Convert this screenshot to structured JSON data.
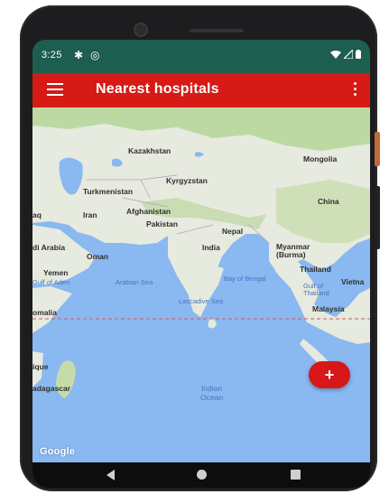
{
  "status_bar": {
    "time": "3:25",
    "icons": [
      "gear-icon",
      "circle-at-icon",
      "wifi-icon",
      "signal-icon",
      "battery-icon"
    ],
    "background": "#1e5e50"
  },
  "app_bar": {
    "title": "Nearest hospitals",
    "menu_icon": "hamburger-menu-icon",
    "overflow_icon": "more-vert-icon",
    "background": "#d61a16"
  },
  "map": {
    "labels": {
      "kazakhstan": "Kazakhstan",
      "mongolia": "Mongolia",
      "kyrgyzstan": "Kyrgyzstan",
      "turkmenistan": "Turkmenistan",
      "afghanistan": "Afghanistan",
      "iraq": "aq",
      "iran": "Iran",
      "pakistan": "Pakistan",
      "china": "China",
      "nepal": "Nepal",
      "saudi_arabia": "di Arabia",
      "oman": "Oman",
      "india": "India",
      "myanmar": "Myanmar\n(Burma)",
      "yemen": "Yemen",
      "thailand": "Thailand",
      "vietnam": "Vietna",
      "gulf_of_aden": "Gulf of Aden",
      "arabian_sea": "Arabian Sea",
      "bay_of_bengal": "Bay of Bengal",
      "gulf_of_thailand": "Gulf of\nThailand",
      "somalia": "omalia",
      "laccadive_sea": "Laccadive Sea",
      "malaysia": "Malaysia",
      "mozambique": "ique",
      "madagascar": "adagascar",
      "indian_ocean": "Indian\nOcean"
    },
    "attribution": "Google",
    "water_color": "#8ab8f0",
    "land_color": "#e6eadf",
    "green_color": "#bcd9a3"
  },
  "fab": {
    "label": "+",
    "color": "#d81818"
  },
  "nav_bar": {
    "back_icon": "back-triangle-icon",
    "home_icon": "home-circle-icon",
    "recents_icon": "recents-square-icon"
  }
}
